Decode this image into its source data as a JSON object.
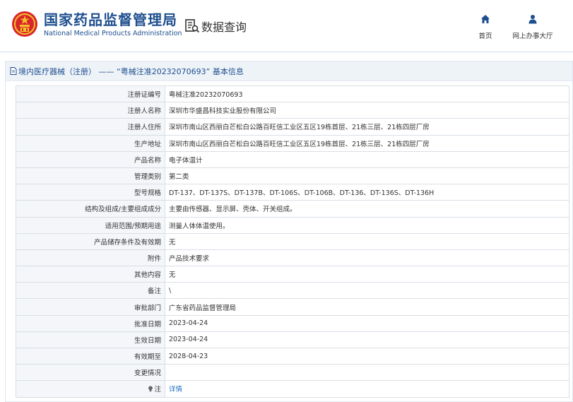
{
  "header": {
    "agency_name_cn": "国家药品监督管理局",
    "agency_name_en": "National Medical Products Administration",
    "data_query_label": "数据查询",
    "nav": {
      "home_label": "首页",
      "office_label": "网上办事大厅"
    }
  },
  "panel": {
    "title": "境内医疗器械（注册） —— “粤械注准20232070693” 基本信息"
  },
  "table": {
    "rows": [
      {
        "label": "注册证编号",
        "value": "粤械注准20232070693"
      },
      {
        "label": "注册人名称",
        "value": "深圳市华盛昌科技实业股份有限公司"
      },
      {
        "label": "注册人住所",
        "value": "深圳市南山区西丽白芒松白公路百旺信工业区五区19栋首层、21栋三层、21栋四层厂房"
      },
      {
        "label": "生产地址",
        "value": "深圳市南山区西丽白芒松白公路百旺信工业区五区19栋首层、21栋三层、21栋四层厂房"
      },
      {
        "label": "产品名称",
        "value": "电子体温计"
      },
      {
        "label": "管理类别",
        "value": "第二类"
      },
      {
        "label": "型号规格",
        "value": "DT-137、DT-137S、DT-137B、DT-106S、DT-106B、DT-136、DT-136S、DT-136H"
      },
      {
        "label": "结构及组成/主要组成成分",
        "value": "主要由传感器、显示屏、壳体、开关组成。"
      },
      {
        "label": "适用范围/预期用途",
        "value": "测量人体体温使用。"
      },
      {
        "label": "产品储存条件及有效期",
        "value": "无"
      },
      {
        "label": "附件",
        "value": "产品技术要求"
      },
      {
        "label": "其他内容",
        "value": "无"
      },
      {
        "label": "备注",
        "value": "\\"
      },
      {
        "label": "审批部门",
        "value": "广东省药品监督管理局"
      },
      {
        "label": "批准日期",
        "value": "2023-04-24"
      },
      {
        "label": "生效日期",
        "value": "2023-04-24"
      },
      {
        "label": "有效期至",
        "value": "2028-04-23"
      },
      {
        "label": "变更情况",
        "value": ""
      }
    ],
    "note_row": {
      "label": "注",
      "link": "详情"
    }
  }
}
